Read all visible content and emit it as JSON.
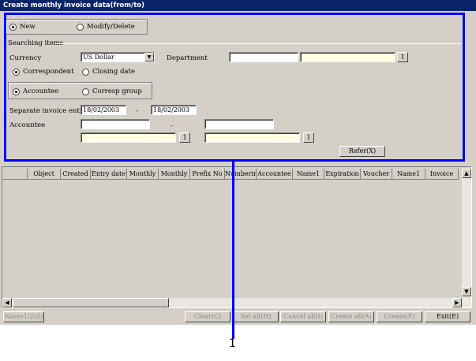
{
  "window": {
    "title": "Create monthly invoice data(from/to)"
  },
  "mode": {
    "new_label": "New",
    "modify_label": "Modify/Delete",
    "selected": "new"
  },
  "search": {
    "group_label": "Searching items",
    "currency_label": "Currency",
    "currency_value": "US Dollar",
    "department_label": "Department",
    "department_code": "",
    "department_name": "",
    "search_btn": "1",
    "correspondent_label": "Correspondent",
    "closing_date_label": "Closing date",
    "accountee_label": "Accountee",
    "corresp_group_label": "Corresp group",
    "separate_entry_label": "Separate invoice entry",
    "date_from": "18/02/2003",
    "date_sep": "-",
    "date_to": "18/02/2003",
    "accountee_field_label": "Accountee",
    "accountee_sep": "-",
    "accountee_from_code": "",
    "accountee_to_code": "",
    "accountee_from_name": "",
    "accountee_to_name": "",
    "refer_label": "Refer(X)"
  },
  "grid": {
    "columns": [
      "",
      "Object",
      "Created",
      "Entry date",
      "Monthly",
      "Monthly",
      "Prefix No",
      "Numbering",
      "Accountee",
      "Name1",
      "Expiration",
      "Voucher",
      "Name1",
      "Invoice"
    ]
  },
  "footer": {
    "name_toggle": "Name1/2(Z)",
    "clear": "Clear(C)",
    "set_all": "Set all(H)",
    "cancel_all": "Cancel all(I)",
    "create_all": "Create all(A)",
    "create": "Create(F)",
    "exit": "Exit(E)"
  },
  "callout": {
    "number": "1",
    "color": "#0000ff"
  }
}
